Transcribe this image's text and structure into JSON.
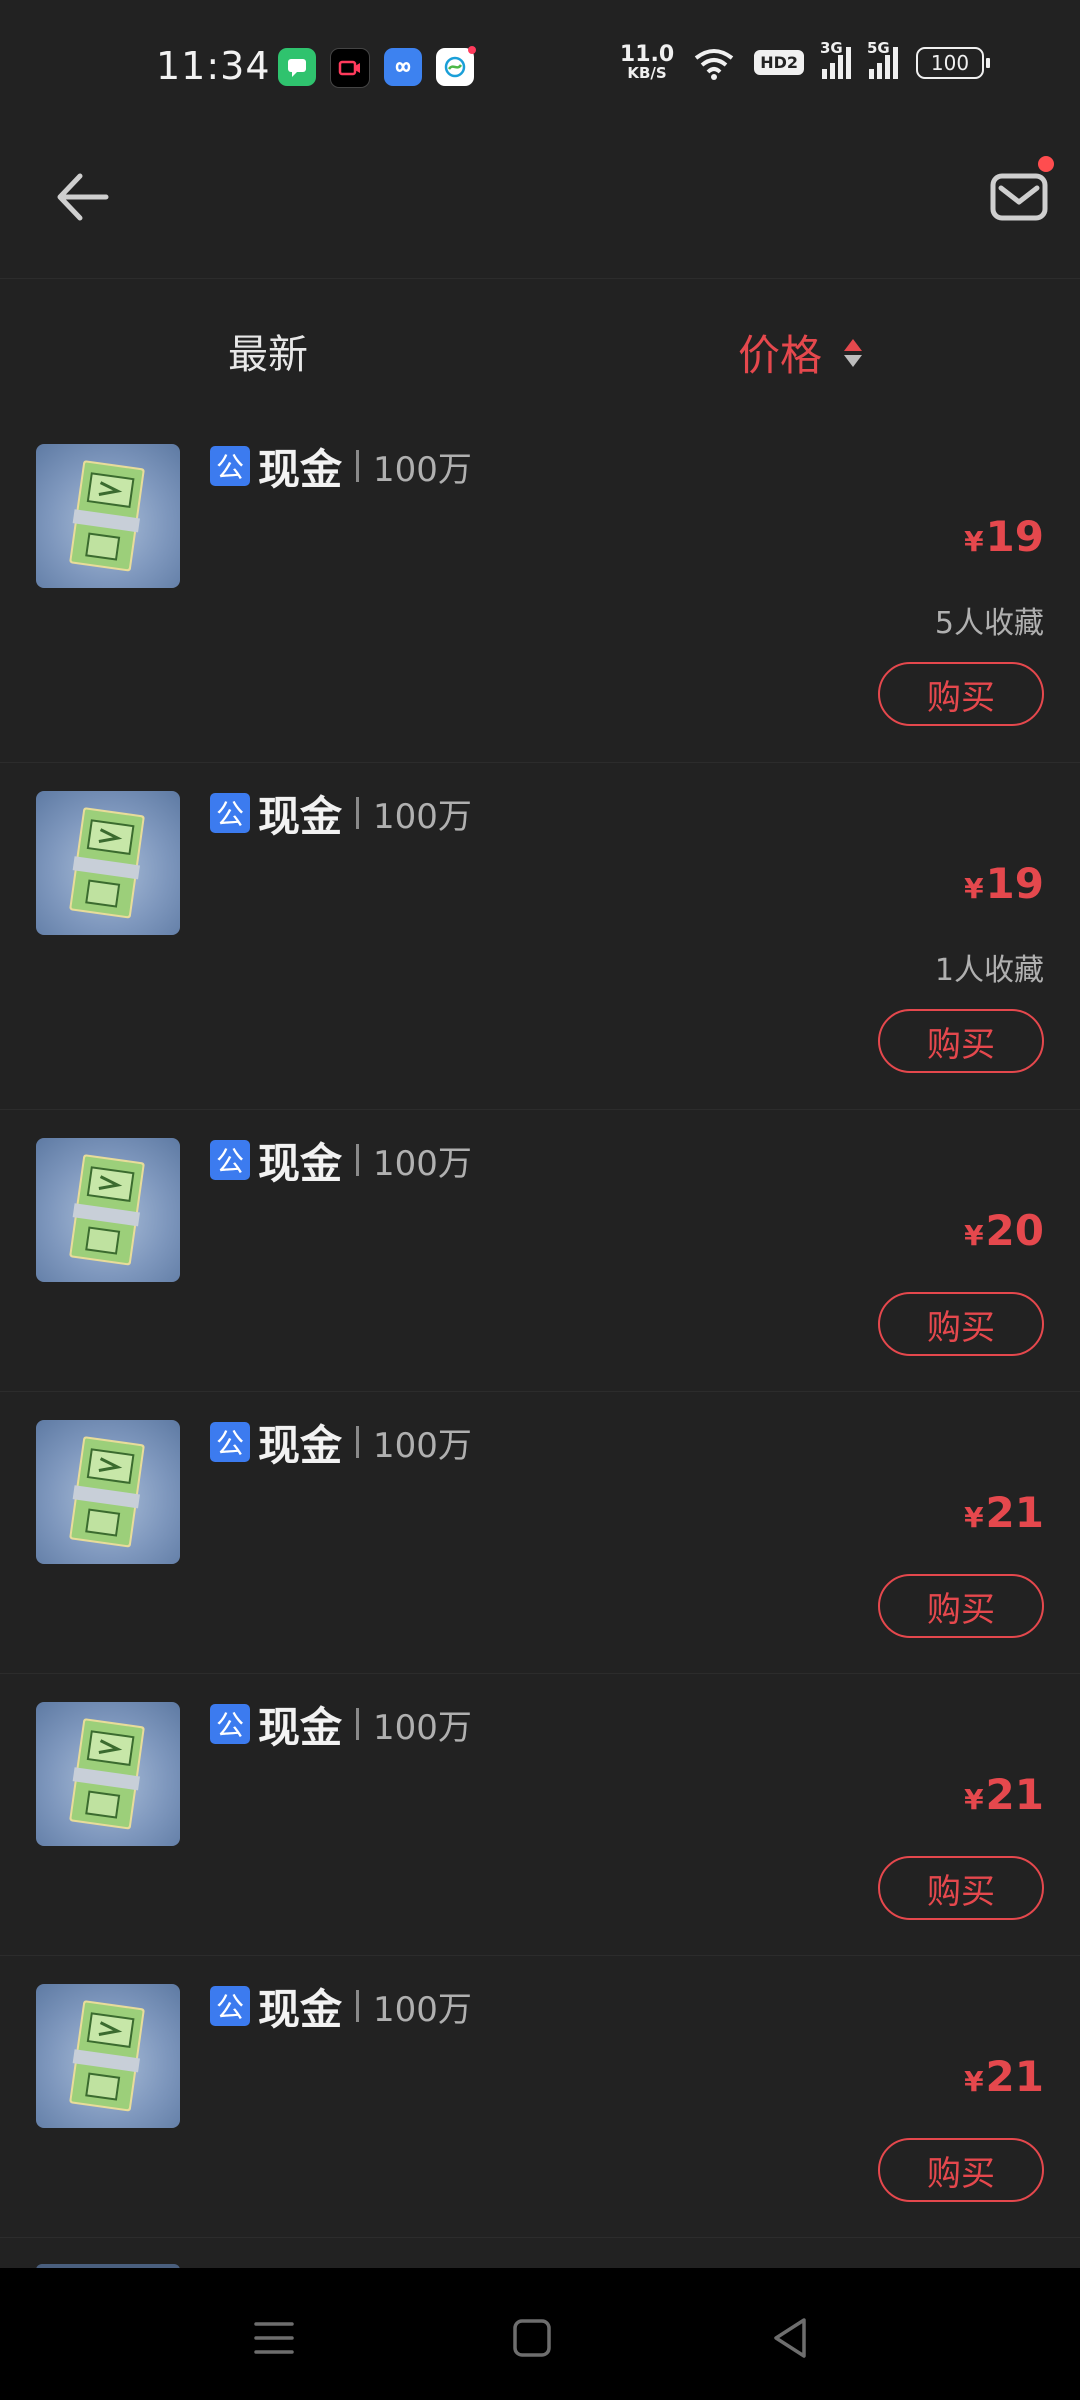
{
  "status_bar": {
    "time": "11:34",
    "net_speed_value": "11.0",
    "net_speed_unit": "KB/S",
    "hd": "HD2",
    "sig1": "3G",
    "sig2": "5G",
    "battery": "100",
    "app_icons": [
      "messages-icon",
      "video-icon",
      "infinity-app-icon",
      "mobile-carrier-icon"
    ]
  },
  "header": {
    "back_icon": "arrow-left-icon",
    "mail_icon": "mail-icon"
  },
  "sort": {
    "latest": "最新",
    "price": "价格"
  },
  "items": [
    {
      "badge": "公",
      "name": "现金",
      "qty": "100万",
      "currency": "¥",
      "price": "19",
      "favs": "5人收藏",
      "buy": "购买"
    },
    {
      "badge": "公",
      "name": "现金",
      "qty": "100万",
      "currency": "¥",
      "price": "19",
      "favs": "1人收藏",
      "buy": "购买"
    },
    {
      "badge": "公",
      "name": "现金",
      "qty": "100万",
      "currency": "¥",
      "price": "20",
      "buy": "购买"
    },
    {
      "badge": "公",
      "name": "现金",
      "qty": "100万",
      "currency": "¥",
      "price": "21",
      "buy": "购买"
    },
    {
      "badge": "公",
      "name": "现金",
      "qty": "100万",
      "currency": "¥",
      "price": "21",
      "buy": "购买"
    },
    {
      "badge": "公",
      "name": "现金",
      "qty": "100万",
      "currency": "¥",
      "price": "21",
      "buy": "购买"
    }
  ],
  "colors": {
    "accent": "#e5484d",
    "badge": "#3c7bef",
    "background": "#222222"
  },
  "navbar": [
    "menu-icon",
    "home-icon",
    "back-triangle-icon"
  ]
}
